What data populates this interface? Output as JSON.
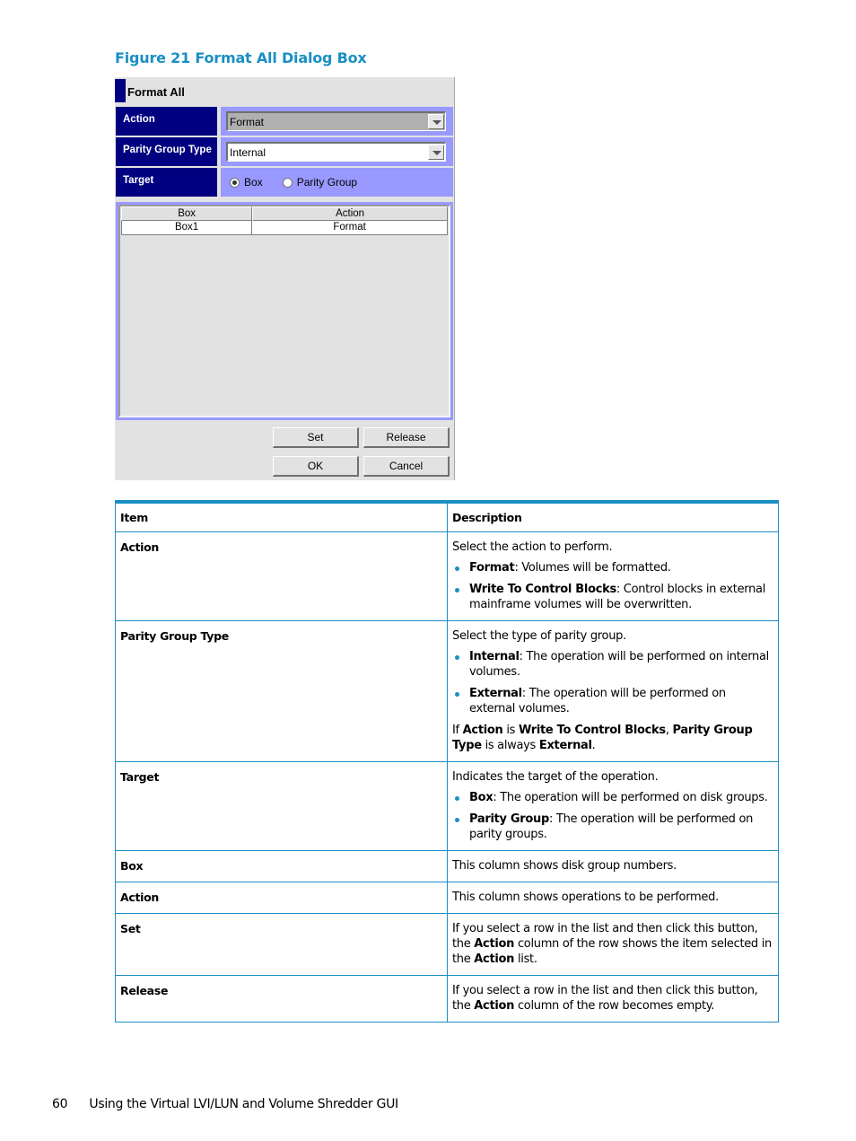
{
  "figure": {
    "caption": "Figure 21 Format All Dialog Box"
  },
  "dialog": {
    "title": "Format All",
    "action": {
      "label": "Action",
      "value": "Format",
      "enabled": false
    },
    "parity_group_type": {
      "label": "Parity Group Type",
      "value": "Internal",
      "enabled": true
    },
    "target": {
      "label": "Target",
      "options": [
        {
          "label": "Box",
          "checked": true
        },
        {
          "label": "Parity Group",
          "checked": false
        }
      ]
    },
    "list": {
      "columns": [
        "Box",
        "Action"
      ],
      "rows": [
        [
          "Box1",
          "Format"
        ]
      ]
    },
    "buttons": {
      "set": "Set",
      "release": "Release",
      "ok": "OK",
      "cancel": "Cancel"
    },
    "colors": {
      "label_bg": "#000080",
      "field_bg": "#9999ff",
      "panel_bg": "#e2e2e2"
    }
  },
  "table": {
    "headers": {
      "item": "Item",
      "description": "Description"
    },
    "rows": [
      {
        "item": "Action",
        "intro": "Select the action to perform.",
        "bullets": [
          {
            "term": "Format",
            "text": ": Volumes will be formatted."
          },
          {
            "term": "Write To Control Blocks",
            "text": ": Control blocks in external mainframe volumes will be overwritten."
          }
        ]
      },
      {
        "item": "Parity Group Type",
        "intro": "Select the type of parity group.",
        "bullets": [
          {
            "term": "Internal",
            "text": ": The operation will be performed on internal volumes."
          },
          {
            "term": "External",
            "text": ": The operation will be performed on external volumes."
          }
        ],
        "note": {
          "p1": "If ",
          "b1": "Action",
          "p2": " is ",
          "b2": "Write To Control Blocks",
          "p3": ", ",
          "b3": "Parity Group Type",
          "p4": " is always ",
          "b4": "External",
          "p5": "."
        }
      },
      {
        "item": "Target",
        "intro": "Indicates the target of the operation.",
        "bullets": [
          {
            "term": "Box",
            "text": ": The operation will be performed on disk groups."
          },
          {
            "term": "Parity Group",
            "text": ": The operation will be performed on parity groups."
          }
        ]
      },
      {
        "item": "Box",
        "intro": "This column shows disk group numbers."
      },
      {
        "item": "Action",
        "intro": "This column shows operations to be performed."
      },
      {
        "item": "Set",
        "desc": {
          "p1": "If you select a row in the list and then click this button, the ",
          "b1": "Action",
          "p2": " column of the row shows the item selected in the ",
          "b2": "Action",
          "p3": " list."
        }
      },
      {
        "item": "Release",
        "desc": {
          "p1": "If you select a row in the list and then click this button, the ",
          "b1": "Action",
          "p2": " column of the row becomes empty."
        }
      }
    ],
    "accent_color": "#1a8fc4"
  },
  "footer": {
    "page_number": "60",
    "section_title": "Using the Virtual LVI/LUN and Volume Shredder GUI"
  }
}
